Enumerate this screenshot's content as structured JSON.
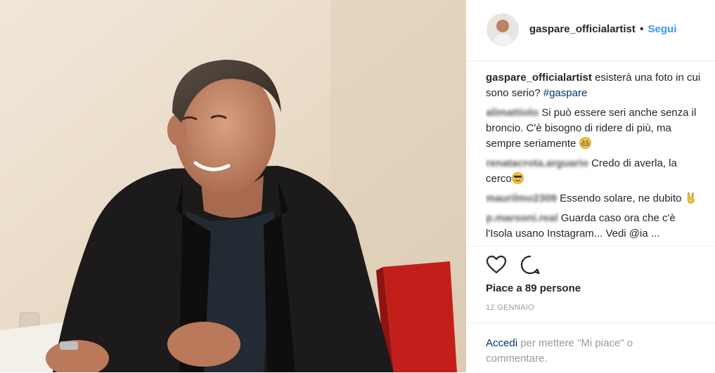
{
  "post": {
    "username": "gaspare_officialartist",
    "separator": "•",
    "follow_label": "Segui"
  },
  "caption": {
    "username": "gaspare_officialartist",
    "text": "esisterà una foto in cui sono serio?",
    "hashtag": "#gaspare"
  },
  "comments": [
    {
      "username": "alimattiolo",
      "text": "Si può essere seri anche senza il broncio. C'è bisogno di ridere di più, ma sempre seriamente",
      "emoji": "grin-emoji"
    },
    {
      "username": "renatacrota.arguario",
      "text": "Credo di averla, la cerco",
      "emoji": "smile-emoji"
    },
    {
      "username": "maurilmo2309",
      "text": "Essendo solare, ne dubito",
      "emoji": "victory-hand-emoji"
    },
    {
      "username": "p.marsoni.real",
      "text": "Guarda caso ora che c'è l'Isola usano Instagram... Vedi @ia ...",
      "emoji": ""
    }
  ],
  "likes": "Piace a 89 persone",
  "date": "12 GENNAIO",
  "login": {
    "link": "Accedi",
    "text": "per mettere \"Mi piace\" o commentare."
  },
  "icons": {
    "like": "heart-icon",
    "comment": "comment-icon"
  }
}
